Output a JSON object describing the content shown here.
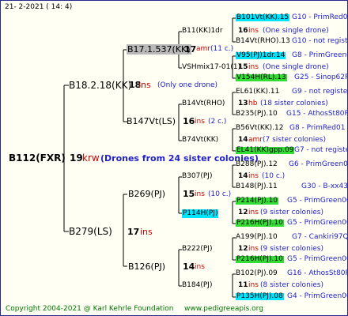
{
  "date": "21-  2-2021 ( 14:  4)",
  "footer": {
    "copyright": "Copyright 2004-2021 @ Karl Kehrle Foundation",
    "site": "www.pedigreeapis.org"
  },
  "root": {
    "id": "B112(FXR)",
    "ins": "19",
    "code": "krw",
    "note": "(Drones from 24 sister colonies)"
  },
  "g1": [
    {
      "id": "B18.2.18(KK)",
      "ins": "18",
      "code": "ins",
      "note": "(Only one drone)"
    },
    {
      "id": "B279(LS)",
      "ins": "17",
      "code": "ins"
    }
  ],
  "g2": [
    {
      "id": "B17.1.537(KK)",
      "ins": "17",
      "code": "amr",
      "note": "(11 c.)"
    },
    {
      "id": "B147Vt(LS)",
      "ins": "16",
      "code": "ins",
      "note": "(2 c.)"
    },
    {
      "id": "B269(PJ)",
      "ins": "15",
      "code": "ins",
      "note": "(10 c.)"
    },
    {
      "id": "B126(PJ)",
      "ins": "14",
      "code": "ins"
    }
  ],
  "g3": [
    {
      "id": "B11(KK)1dr",
      "ins": "16",
      "code": "ins",
      "note": "(One single drone)"
    },
    {
      "id": "VSHmix17-01(1)",
      "ins": "15",
      "code": "ins",
      "note": "(One single drone)"
    },
    {
      "id": "B14Vt(RHO)",
      "ins": "13",
      "code": "hb",
      "note": "(18 sister colonies)"
    },
    {
      "id": "B74Vt(KK)",
      "ins": "14",
      "code": "amr",
      "note": "(7 sister colonies)"
    },
    {
      "id": "B307(PJ)",
      "ins": "14",
      "code": "ins",
      "note": "(10 c.)"
    },
    {
      "id": "P114H(PJ)",
      "ins": "12",
      "code": "ins",
      "note": "(9 sister colonies)"
    },
    {
      "id": "B222(PJ)",
      "ins": "12",
      "code": "ins",
      "note": "(9 sister colonies)"
    },
    {
      "id": "B184(PJ)",
      "ins": "11",
      "code": "ins",
      "note": "(8 sister colonies)"
    }
  ],
  "g4": [
    {
      "id": "B101Vt(KK).15",
      "ref": "G10 - PrimRed01"
    },
    {
      "id": "B14Vt(RHO).13",
      "ref": "G10 - not registe"
    },
    {
      "id": "V95(PJ)1dr.14",
      "ref": "G8 - PrimGreen00"
    },
    {
      "id": "V154H(RL).13",
      "ref": "G25 - Sinop62R"
    },
    {
      "id": "EL61(KK).11",
      "ref": "G9 - not registe"
    },
    {
      "id": "B235(PJ).10",
      "ref": "G15 - AthosSt80R"
    },
    {
      "id": "B56Vt(KK).12",
      "ref": "G8 - PrimRed01"
    },
    {
      "id": "EL41(KK)gpp.09",
      "ref": "G7 - not registe"
    },
    {
      "id": "B288(PJ).12",
      "ref": "G6 - PrimGreen00"
    },
    {
      "id": "B148(PJ).11",
      "ref": "G30 - B-xx43"
    },
    {
      "id": "P214(PJ).10",
      "ref": "G5 - PrimGreen00"
    },
    {
      "id": "P216H(PJ).10",
      "ref": "G5 - PrimGreen00"
    },
    {
      "id": "A199(PJ).10",
      "ref": "G7 - Cankiri97Q"
    },
    {
      "id": "P216H(PJ).10",
      "ref": "G5 - PrimGreen00"
    },
    {
      "id": "B102(PJ).09",
      "ref": "G16 - AthosSt80R"
    },
    {
      "id": "P135H(PJ).08",
      "ref": "G4 - PrimGreen00"
    }
  ]
}
